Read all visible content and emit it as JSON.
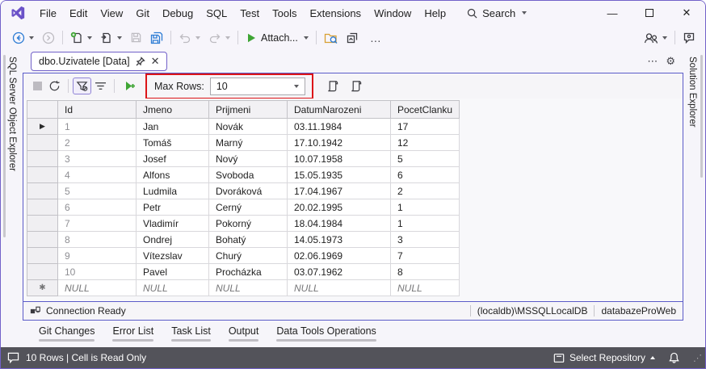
{
  "titlebar": {
    "menu_items": [
      "File",
      "Edit",
      "View",
      "Git",
      "Debug",
      "SQL",
      "Test",
      "Tools",
      "Extensions",
      "Window",
      "Help"
    ],
    "search_label": "Search"
  },
  "toolbar": {
    "attach_label": "Attach..."
  },
  "tab": {
    "title": "dbo.Uzivatele [Data]"
  },
  "side_panels": {
    "left": "SQL Server Object Explorer",
    "right": "Solution Explorer"
  },
  "grid_toolbar": {
    "max_rows_label": "Max Rows:",
    "max_rows_value": "10"
  },
  "table": {
    "columns": [
      "Id",
      "Jmeno",
      "Prijmeni",
      "DatumNarozeni",
      "PocetClanku"
    ],
    "rows": [
      [
        "1",
        "Jan",
        "Novák",
        "03.11.1984",
        "17"
      ],
      [
        "2",
        "Tomáš",
        "Marný",
        "17.10.1942",
        "12"
      ],
      [
        "3",
        "Josef",
        "Nový",
        "10.07.1958",
        "5"
      ],
      [
        "4",
        "Alfons",
        "Svoboda",
        "15.05.1935",
        "6"
      ],
      [
        "5",
        "Ludmila",
        "Dvoráková",
        "17.04.1967",
        "2"
      ],
      [
        "6",
        "Petr",
        "Cerný",
        "20.02.1995",
        "1"
      ],
      [
        "7",
        "Vladimír",
        "Pokorný",
        "18.04.1984",
        "1"
      ],
      [
        "8",
        "Ondrej",
        "Bohatý",
        "14.05.1973",
        "3"
      ],
      [
        "9",
        "Vítezslav",
        "Churý",
        "02.06.1969",
        "7"
      ],
      [
        "10",
        "Pavel",
        "Procházka",
        "03.07.1962",
        "8"
      ]
    ],
    "first_row_marker": "▶",
    "new_row_marker": "✱",
    "new_row": [
      "NULL",
      "NULL",
      "NULL",
      "NULL",
      "NULL"
    ]
  },
  "connection_bar": {
    "status": "Connection Ready",
    "server": "(localdb)\\MSSQLLocalDB",
    "database": "databazeProWeb"
  },
  "bottom_tabs": [
    "Git Changes",
    "Error List",
    "Task List",
    "Output",
    "Data Tools Operations"
  ],
  "statusbar": {
    "left_text": "10 Rows | Cell is Read Only",
    "repository_label": "Select Repository"
  },
  "icons": {
    "minimize": "—",
    "close": "✕",
    "tab_close": "✕",
    "gear": "⚙",
    "ellipsis": "⋯",
    "overflow": "…",
    "grip": "⋰"
  },
  "colors": {
    "window_border": "#7261c9",
    "editor_border": "#5b5bc8",
    "highlight_red": "#dc1418",
    "accent_green": "#3fa535",
    "statusbar_bg": "#53535a"
  }
}
